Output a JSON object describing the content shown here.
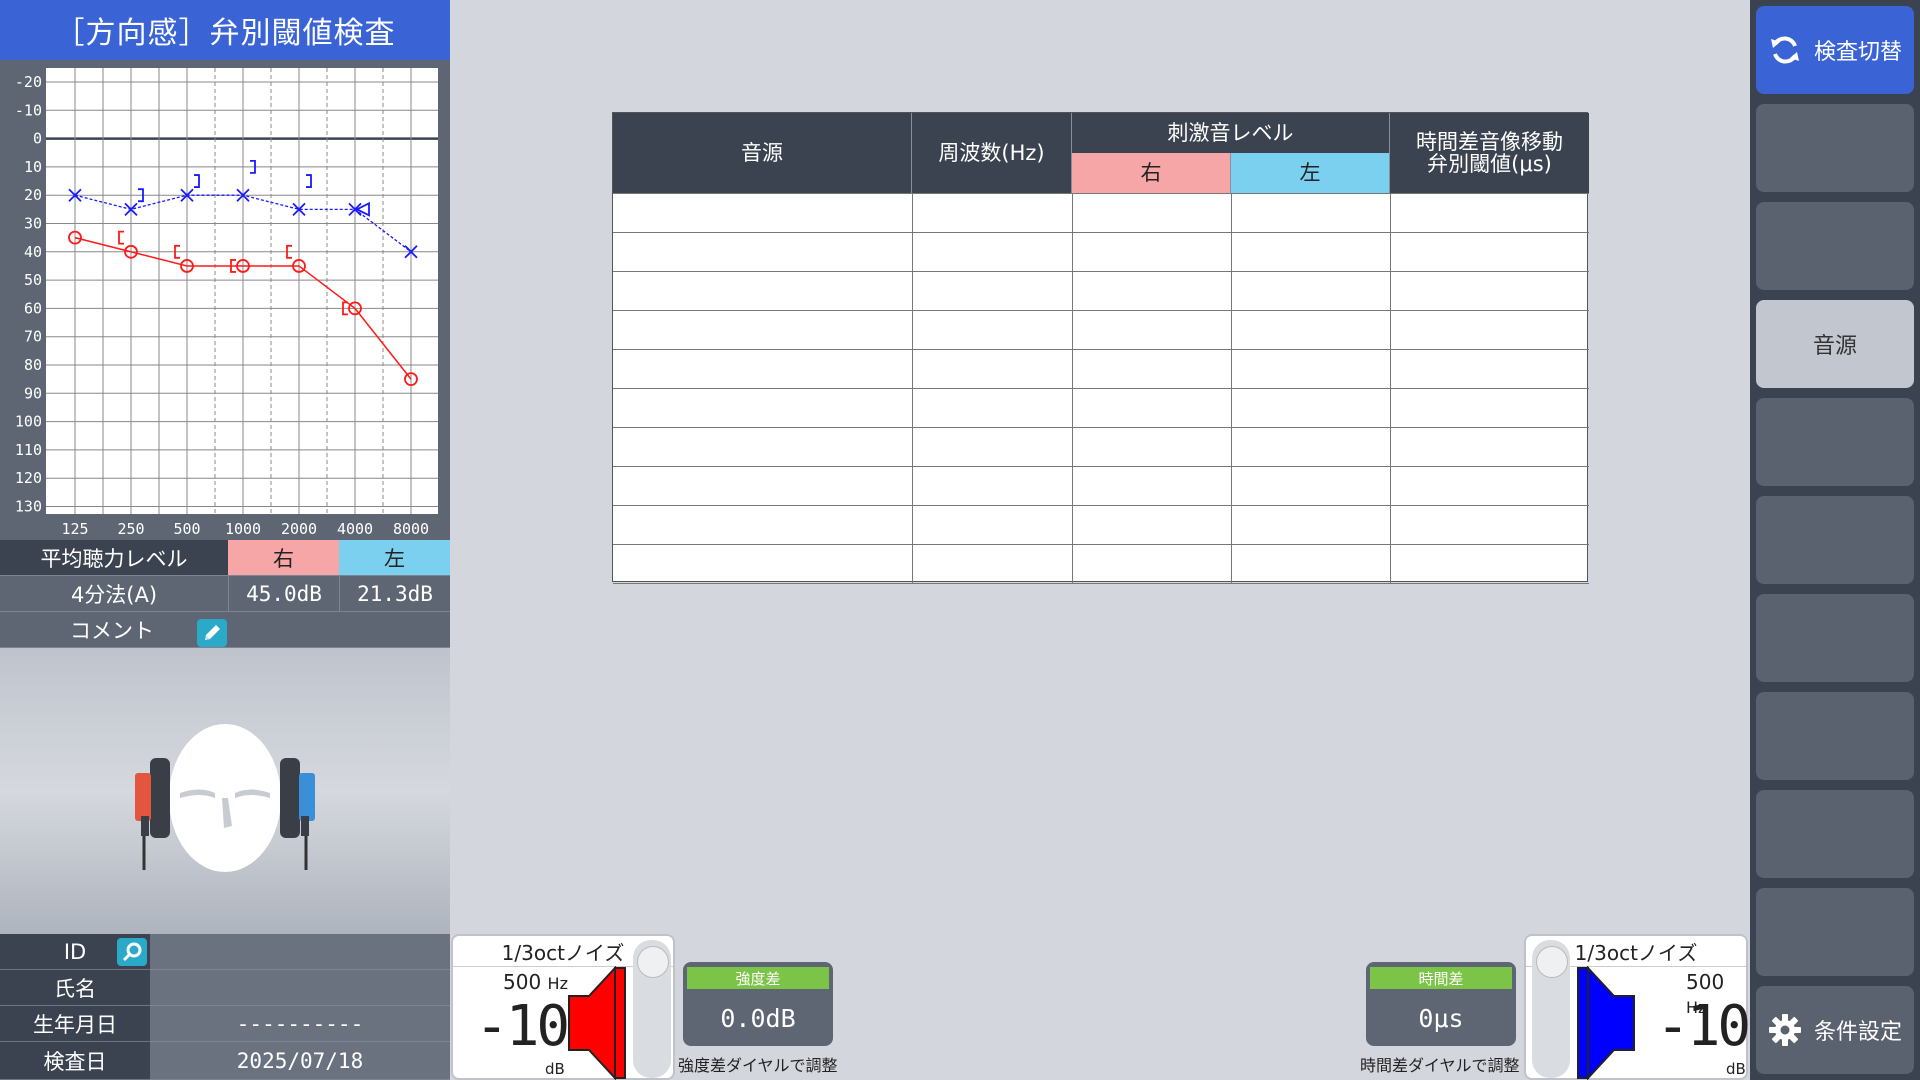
{
  "header": {
    "title": "［方向感］弁別閾値検査"
  },
  "audiogram": {
    "y_ticks": [
      "-20",
      "-10",
      "0",
      "10",
      "20",
      "30",
      "40",
      "50",
      "60",
      "70",
      "80",
      "90",
      "100",
      "110",
      "120",
      "130"
    ],
    "x_ticks": [
      "125",
      "250",
      "500",
      "1000",
      "2000",
      "4000",
      "8000"
    ],
    "colors": {
      "right": "#ff1a1a",
      "left": "#1a1aff"
    }
  },
  "average": {
    "header_label": "平均聴力レベル",
    "right_label": "右",
    "left_label": "左",
    "method": "4分法(A)",
    "right_value": "45.0dB",
    "left_value": "21.3dB",
    "comment_label": "コメント"
  },
  "patient": {
    "id_label": "ID",
    "name_label": "氏名",
    "birth_label": "生年月日",
    "birth_value": "----------",
    "exam_date_label": "検査日",
    "exam_date_value": "2025/07/18"
  },
  "table": {
    "col_source": "音源",
    "col_freq": "周波数(Hz)",
    "col_stim": "刺激音レベル",
    "col_right": "右",
    "col_left": "左",
    "col_threshold_line1": "時間差音像移動",
    "col_threshold_line2": "弁別閾値(μs)"
  },
  "sidebar": {
    "switch_label": "検査切替",
    "source_label": "音源",
    "settings_label": "条件設定"
  },
  "right_channel": {
    "signal": "1/3octノイズ",
    "freq": "500",
    "freq_unit": "Hz",
    "level": "-10",
    "level_unit": "dB",
    "color": "#ff0000"
  },
  "left_channel": {
    "signal": "1/3octノイズ",
    "freq": "500",
    "freq_unit": "Hz",
    "level": "-10",
    "level_unit": "dB",
    "color": "#0000ff"
  },
  "intensity_diff": {
    "label": "強度差",
    "value": "0.0dB",
    "note": "強度差ダイヤルで調整"
  },
  "time_diff": {
    "label": "時間差",
    "value": "0μs",
    "note": "時間差ダイヤルで調整"
  }
}
